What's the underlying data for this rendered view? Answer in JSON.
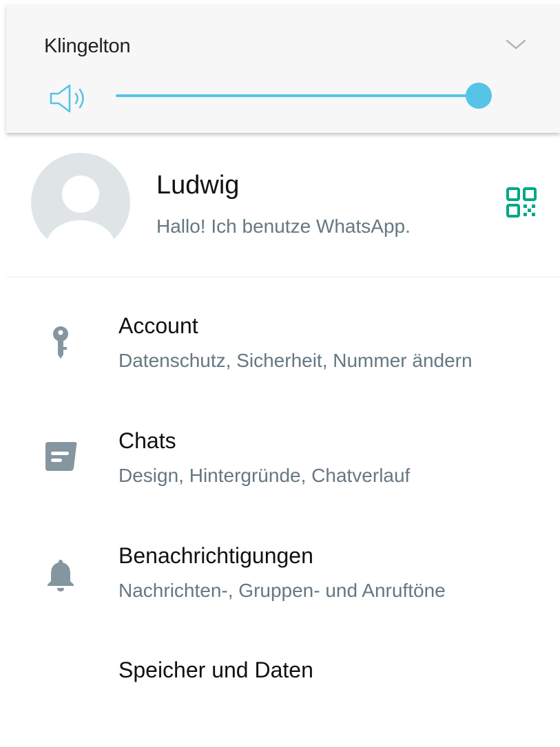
{
  "volume": {
    "title": "Klingelton",
    "level_percent": 100,
    "accent_color": "#56c4e6",
    "icons": [
      "speaker-icon",
      "chevron-down-icon"
    ]
  },
  "profile": {
    "name": "Ludwig",
    "status": "Hallo! Ich benutze WhatsApp.",
    "qr_icon": "qr-code-icon",
    "qr_color": "#00a884"
  },
  "settings": [
    {
      "title": "Account",
      "subtitle": "Datenschutz, Sicherheit, Nummer ändern",
      "icon": "key-icon"
    },
    {
      "title": "Chats",
      "subtitle": "Design, Hintergründe, Chatverlauf",
      "icon": "chat-icon"
    },
    {
      "title": "Benachrichtigungen",
      "subtitle": "Nachrichten-, Gruppen- und Anruftöne",
      "icon": "bell-icon"
    },
    {
      "title": "Speicher und Daten",
      "subtitle": "",
      "icon": ""
    }
  ]
}
